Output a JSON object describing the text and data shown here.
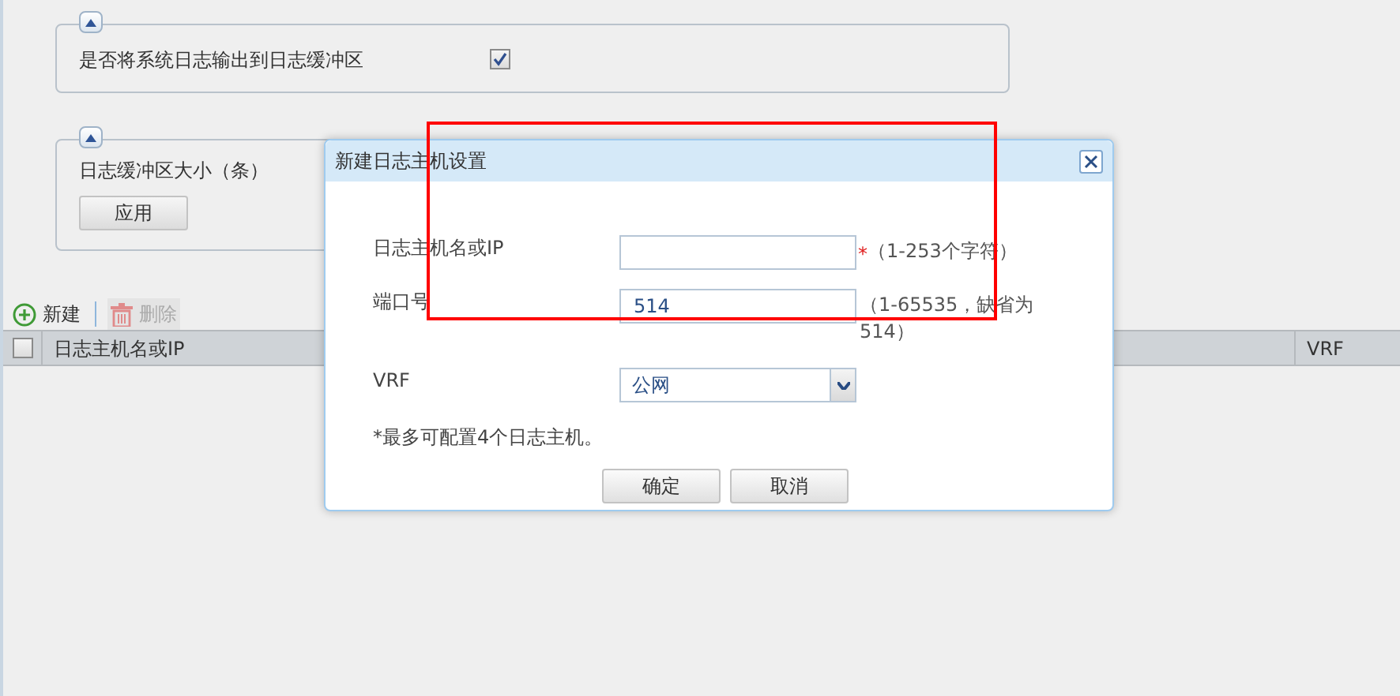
{
  "sections": [
    {
      "kind": "checkbox",
      "label": "是否将系统日志输出到日志缓冲区",
      "checked": true
    },
    {
      "kind": "button",
      "label": "日志缓冲区大小（条）",
      "button": "应用"
    }
  ],
  "toolbar": [
    {
      "kind": "add",
      "label": "新建",
      "disabled": false
    },
    {
      "kind": "delete",
      "label": "删除",
      "disabled": true
    }
  ],
  "table": {
    "select_all_checked": false,
    "columns": [
      "日志主机名或IP",
      "VRF"
    ]
  },
  "dialog": {
    "title": "新建日志主机设置",
    "fields": [
      {
        "kind": "text",
        "label": "日志主机名或IP",
        "required_mark": "*",
        "hint": "（1-253个字符）"
      },
      {
        "kind": "text",
        "label": "端口号",
        "value": "514",
        "hint": "（1-65535，缺省为514）"
      },
      {
        "kind": "select",
        "label": "VRF",
        "value": "公网"
      }
    ],
    "note": "*最多可配置4个日志主机。",
    "buttons": [
      "确定",
      "取消"
    ]
  }
}
